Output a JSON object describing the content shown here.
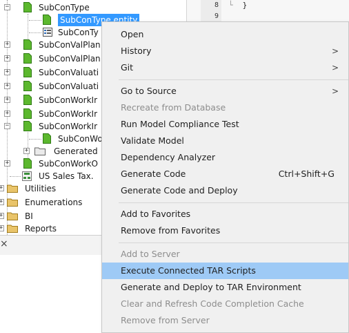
{
  "tree": {
    "items": [
      {
        "label": "SubConType"
      },
      {
        "label": "SubConType.entity"
      },
      {
        "label": "SubConTy"
      },
      {
        "label": "SubConValPlan"
      },
      {
        "label": "SubConValPlan"
      },
      {
        "label": "SubConValuati"
      },
      {
        "label": "SubConValuati"
      },
      {
        "label": "SubConWorkIr"
      },
      {
        "label": "SubConWorkIr"
      },
      {
        "label": "SubConWorkIr"
      },
      {
        "label": "SubConWo"
      },
      {
        "label": "Generated"
      },
      {
        "label": "SubConWorkO"
      },
      {
        "label": "US Sales Tax."
      },
      {
        "label": "Utilities"
      },
      {
        "label": "Enumerations"
      },
      {
        "label": "BI"
      },
      {
        "label": "Reports"
      }
    ]
  },
  "editor": {
    "line_numbers": [
      "8",
      "9"
    ],
    "code_line": "}"
  },
  "panel": {
    "close_glyph": "×"
  },
  "context_menu": {
    "items": [
      {
        "label": "Open"
      },
      {
        "label": "History",
        "arrow": ">"
      },
      {
        "label": "Git",
        "arrow": ">"
      },
      {
        "label": "Go to Source",
        "arrow": ">"
      },
      {
        "label": "Recreate from Database"
      },
      {
        "label": "Run Model Compliance Test"
      },
      {
        "label": "Validate Model"
      },
      {
        "label": "Dependency Analyzer"
      },
      {
        "label": "Generate Code",
        "shortcut": "Ctrl+Shift+G"
      },
      {
        "label": "Generate Code and Deploy"
      },
      {
        "label": "Add to Favorites"
      },
      {
        "label": "Remove from Favorites"
      },
      {
        "label": "Add to Server"
      },
      {
        "label": "Execute Connected TAR Scripts"
      },
      {
        "label": "Generate and Deploy to TAR Environment"
      },
      {
        "label": "Clear and Refresh Code Completion Cache"
      },
      {
        "label": "Remove from Server"
      }
    ]
  },
  "colors": {
    "selection": "#3399ff",
    "menu_highlight": "#9ecaf6",
    "menu_background": "#f0f0f0",
    "disabled_text": "#8d8d8d",
    "folder_icon": "#e9c46a",
    "file_icon": "#5cb82e"
  }
}
